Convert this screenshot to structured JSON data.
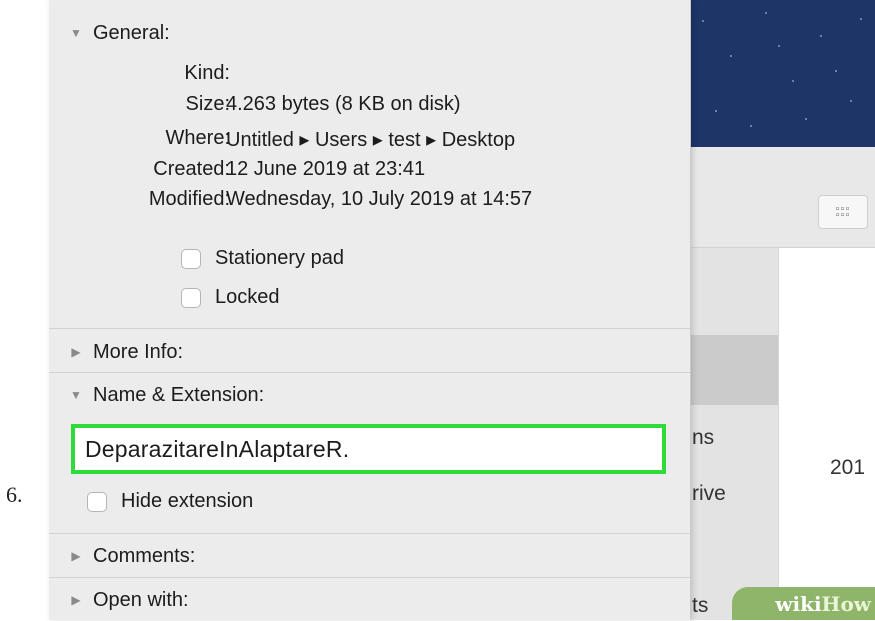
{
  "step_number": "6.",
  "panel": {
    "general": {
      "header": "General:",
      "rows": [
        {
          "label": "Kind:",
          "value": ""
        },
        {
          "label": "Size:",
          "value": "4.263 bytes (8 KB on disk)"
        },
        {
          "label": "Where:",
          "value": "Untitled ▸ Users ▸ test ▸ Desktop"
        },
        {
          "label": "Created:",
          "value": "12 June 2019 at 23:41"
        },
        {
          "label": "Modified:",
          "value": "Wednesday, 10 July 2019 at 14:57"
        }
      ],
      "stationery_label": "Stationery pad",
      "locked_label": "Locked"
    },
    "more_info": {
      "header": "More Info:"
    },
    "name_extension": {
      "header": "Name & Extension:",
      "name_value": "DeparazitareInAlaptareR.",
      "hide_extension_label": "Hide extension"
    },
    "comments": {
      "header": "Comments:"
    },
    "open_with": {
      "header": "Open with:"
    }
  },
  "background_window": {
    "sidebar_fragments": [
      "ns",
      "rive",
      "ts"
    ],
    "content_fragment": "201"
  },
  "watermark": {
    "wiki": "wiki",
    "how": "How"
  },
  "colors": {
    "panel_bg": "#ececec",
    "highlight": "#2fdb3a",
    "sky": "#1d3567",
    "badge": "#8fb56b"
  }
}
